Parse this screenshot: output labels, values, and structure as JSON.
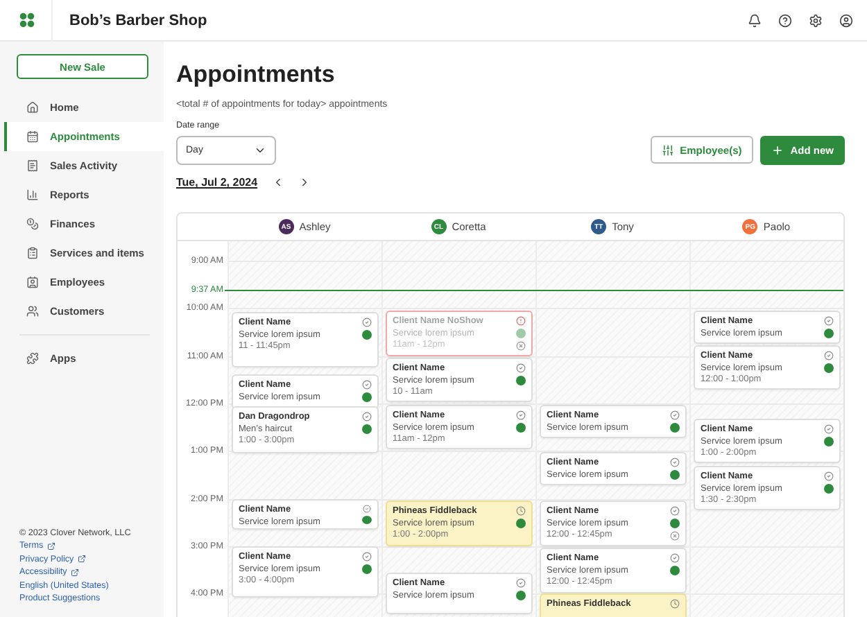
{
  "header": {
    "title": "Bob’s Barber Shop"
  },
  "sidebar": {
    "new_sale": "New Sale",
    "items": [
      {
        "label": "Home",
        "selected": false
      },
      {
        "label": "Appointments",
        "selected": true
      },
      {
        "label": "Sales Activity",
        "selected": false
      },
      {
        "label": "Reports",
        "selected": false
      },
      {
        "label": "Finances",
        "selected": false
      },
      {
        "label": "Services and items",
        "selected": false
      },
      {
        "label": "Employees",
        "selected": false
      },
      {
        "label": "Customers",
        "selected": false
      }
    ],
    "apps": {
      "label": "Apps",
      "selected": false
    },
    "footer": {
      "copyright": "© 2023 Clover Network, LLC",
      "links": [
        {
          "label": "Terms",
          "external": true
        },
        {
          "label": "Privacy Policy",
          "external": true
        },
        {
          "label": "Accessibility",
          "external": true
        },
        {
          "label": "English (United States)",
          "external": false
        },
        {
          "label": "Product Suggestions",
          "external": false
        }
      ]
    }
  },
  "page": {
    "title": "Appointments",
    "subtitle": "<total # of appointments for today> appointments",
    "date_range": {
      "label": "Date range",
      "value": "Day"
    },
    "date": "Tue, Jul 2, 2024",
    "employees_button": "Employee(s)",
    "add_button": "Add new"
  },
  "calendar": {
    "employees": [
      {
        "initials": "AS",
        "name": "Ashley",
        "color": "#4b2a5c"
      },
      {
        "initials": "CL",
        "name": "Coretta",
        "color": "#2e8b3e"
      },
      {
        "initials": "TT",
        "name": "Tony",
        "color": "#2f5b8c"
      },
      {
        "initials": "PG",
        "name": "Paolo",
        "color": "#f2703c"
      }
    ],
    "times": [
      "9:00 AM",
      "10:00 AM",
      "11:00 AM",
      "12:00 PM",
      "1:00 PM",
      "2:00 PM",
      "3:00 PM",
      "4:00 PM"
    ],
    "now": "9:37 AM",
    "columns": [
      [
        {
          "client": "Client Name",
          "service": "Service lorem ipsum",
          "time": "11 - 11:45pm",
          "kind": "booked",
          "cancel": false
        },
        {
          "client": "Client Name",
          "service": "Service lorem ipsum",
          "kind": "booked",
          "cancel": false
        },
        {
          "client": "Dan Dragondrop",
          "service": "Men’s haircut",
          "time": "1:00 - 3:00pm",
          "kind": "booked",
          "cancel": false
        },
        {
          "client": "Client Name",
          "service": "Service lorem ipsum",
          "kind": "booked",
          "cancel": false
        },
        {
          "client": "Client Name",
          "service": "Service lorem ipsum",
          "time": "3:00 - 4:00pm",
          "kind": "booked",
          "cancel": false
        }
      ],
      [
        {
          "client": "Client Name NoShow",
          "service": "Service lorem ipsum",
          "time": "11am - 12pm",
          "kind": "noshow",
          "cancel": true
        },
        {
          "client": "Client Name",
          "service": "Service lorem ipsum",
          "time": "10 - 11am",
          "kind": "booked",
          "cancel": false
        },
        {
          "client": "Client Name",
          "service": "Service lorem ipsum",
          "time": "11am - 12pm",
          "kind": "booked",
          "cancel": false
        },
        {
          "client": "Phineas Fiddleback",
          "service": "Service lorem ipsum",
          "time": "1:00 - 2:00pm",
          "kind": "pending",
          "cancel": false
        },
        {
          "client": "Client Name",
          "service": "Service lorem ipsum",
          "kind": "booked",
          "cancel": false
        }
      ],
      [
        {
          "client": "Client Name",
          "service": "Service lorem ipsum",
          "kind": "booked",
          "cancel": false
        },
        {
          "client": "Client Name",
          "service": "Service lorem ipsum",
          "kind": "booked",
          "cancel": false
        },
        {
          "client": "Client Name",
          "service": "Service lorem ipsum",
          "time": "12:00 - 12:45pm",
          "kind": "booked",
          "cancel": true
        },
        {
          "client": "Client Name",
          "service": "Service lorem ipsum",
          "time": "12:00 - 12:45pm",
          "kind": "booked",
          "cancel": false
        },
        {
          "client": "Phineas Fiddleback",
          "kind": "pending",
          "cancel": false
        }
      ],
      [
        {
          "client": "Client Name",
          "service": "Service lorem ipsum",
          "kind": "booked",
          "cancel": false
        },
        {
          "client": "Client Name",
          "service": "Service lorem ipsum",
          "time": "12:00 - 1:00pm",
          "kind": "booked",
          "cancel": false
        },
        {
          "client": "Client Name",
          "service": "Service lorem ipsum",
          "time": "1:00 - 2:00pm",
          "kind": "booked",
          "cancel": false
        },
        {
          "client": "Client Name",
          "service": "Service lorem ipsum",
          "time": "1:30 - 2:30pm",
          "kind": "booked",
          "cancel": false
        }
      ]
    ]
  }
}
